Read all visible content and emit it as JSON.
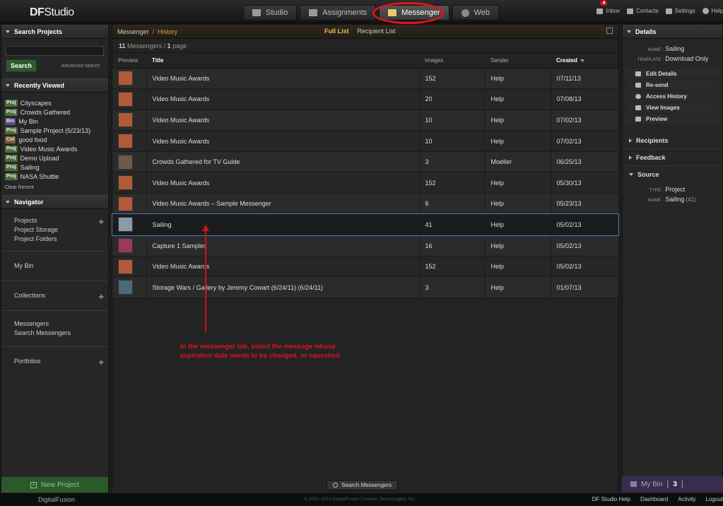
{
  "app": {
    "logo_main": "DF",
    "logo_sub": "Studio",
    "tabs": [
      {
        "label": "Studio"
      },
      {
        "label": "Assignments"
      },
      {
        "label": "Messenger"
      },
      {
        "label": "Web"
      }
    ],
    "toplinks": {
      "inbox_label": "Inbox",
      "inbox_count": "4",
      "contacts_label": "Contacts",
      "settings_label": "Settings",
      "help_label": "Help"
    }
  },
  "left": {
    "search_title": "Search Projects",
    "search_button": "Search",
    "advanced_search": "Advanced search",
    "recent_title": "Recently Viewed",
    "recent": [
      {
        "tag": "Proj",
        "label": "Cityscapes"
      },
      {
        "tag": "Proj",
        "label": "Crowds Gathered"
      },
      {
        "tag": "Bin",
        "label": "My Bin"
      },
      {
        "tag": "Proj",
        "label": "Sample Project (5/23/13)"
      },
      {
        "tag": "Col",
        "label": "good food"
      },
      {
        "tag": "Proj",
        "label": "Video Music Awards"
      },
      {
        "tag": "Proj",
        "label": "Demo Upload"
      },
      {
        "tag": "Proj",
        "label": "Sailing"
      },
      {
        "tag": "Proj",
        "label": "NASA Shuttle"
      }
    ],
    "clear_recent": "Clear Recent",
    "navigator_title": "Navigator",
    "nav": {
      "projects": "Projects",
      "project_storage": "Project Storage",
      "project_folders": "Project Folders",
      "my_bin": "My Bin",
      "collections": "Collections",
      "messengers": "Messengers",
      "search_messengers": "Search Messengers",
      "portfolios": "Portfolios"
    },
    "new_project": "New Project"
  },
  "center": {
    "crumb1": "Messenger",
    "crumb_sep": "/",
    "crumb2": "History",
    "list_tabs": {
      "full": "Full List",
      "recipient": "Recipient List"
    },
    "count": "11",
    "count_label": "Messengers",
    "count_sep": "/",
    "pages": "1",
    "pages_label": "page",
    "columns": {
      "preview": "Preview",
      "title": "Title",
      "images": "Images",
      "sender": "Sender",
      "created": "Created"
    },
    "rows": [
      {
        "title": "Video Music Awards",
        "images": "152",
        "sender": "Help",
        "created": "07/11/13",
        "thumb_color": "#b05a3a"
      },
      {
        "title": "Video Music Awards",
        "images": "20",
        "sender": "Help",
        "created": "07/08/13",
        "thumb_color": "#b05a3a"
      },
      {
        "title": "Video Music Awards",
        "images": "10",
        "sender": "Help",
        "created": "07/02/13",
        "thumb_color": "#b05a3a"
      },
      {
        "title": "Video Music Awards",
        "images": "10",
        "sender": "Help",
        "created": "07/02/13",
        "thumb_color": "#b05a3a"
      },
      {
        "title": "Crowds Gathered for TV Guide",
        "images": "3",
        "sender": "Moeller",
        "created": "06/25/13",
        "thumb_color": "#6a5a4a"
      },
      {
        "title": "Video Music Awards",
        "images": "152",
        "sender": "Help",
        "created": "05/30/13",
        "thumb_color": "#b05a3a"
      },
      {
        "title": "Video Music Awards – Sample Messenger",
        "images": "6",
        "sender": "Help",
        "created": "05/23/13",
        "thumb_color": "#b05a3a"
      },
      {
        "title": "Sailing",
        "images": "41",
        "sender": "Help",
        "created": "05/02/13",
        "thumb_color": "#8a9aa8"
      },
      {
        "title": "Capture 1 Samples",
        "images": "16",
        "sender": "Help",
        "created": "05/02/13",
        "thumb_color": "#9a3a5a"
      },
      {
        "title": "Video Music Awards",
        "images": "152",
        "sender": "Help",
        "created": "05/02/13",
        "thumb_color": "#b05a3a"
      },
      {
        "title": "Storage Wars / Gallery by Jeremy Cowart (6/24/11) (6/24/11)",
        "images": "3",
        "sender": "Help",
        "created": "01/07/13",
        "thumb_color": "#4a6a7a"
      }
    ],
    "annotation": "In the messenger tab, select the message whose expiration date needs to be changed, or cancelled.",
    "search_messengers": "Search Messengers"
  },
  "right": {
    "details_title": "Details",
    "name_key": "NAME :",
    "name_val": "Sailing",
    "template_key": "TEMPLATE :",
    "template_val": "Download Only",
    "actions": [
      "Edit Details",
      "Re-send",
      "Access History",
      "View Images",
      "Preview"
    ],
    "recipients": "Recipients",
    "feedback": "Feedback",
    "source": "Source",
    "type_key": "TYPE :",
    "type_val": "Project",
    "sname_key": "NAME :",
    "sname_val": "Sailing",
    "sname_count": "(41)",
    "my_bin": "My Bin",
    "my_bin_count": "3"
  },
  "footer": {
    "logo": "DigitalFusion",
    "copyright": "© 2000–2013 DigitalFusion Creative Technologies, Inc.",
    "links": [
      "DF Studio Help",
      "Dashboard",
      "Activity",
      "Logout"
    ]
  }
}
